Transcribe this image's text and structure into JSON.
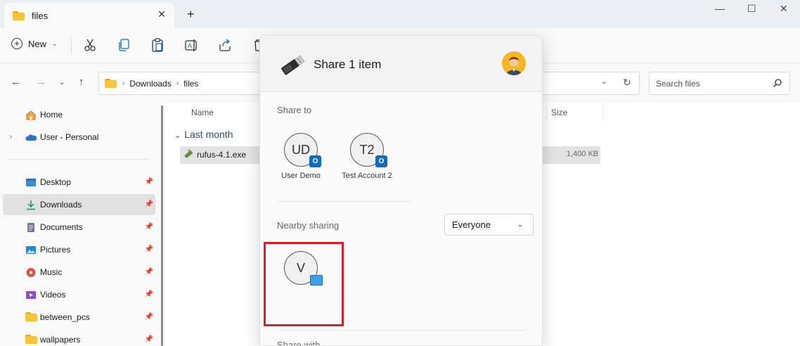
{
  "window": {
    "tab_title": "files",
    "new_tab": "+",
    "minimize": "—",
    "maximize": "☐",
    "close": "✕"
  },
  "toolbar": {
    "new_label": "New",
    "icons": [
      "cut-icon",
      "copy-icon",
      "paste-icon",
      "rename-icon",
      "share-icon",
      "delete-icon"
    ]
  },
  "address": {
    "crumbs": [
      "Downloads",
      "files"
    ],
    "search_placeholder": "Search files"
  },
  "sidebar": {
    "items": [
      {
        "label": "Home",
        "icon": "home-icon"
      },
      {
        "label": "User - Personal",
        "icon": "onedrive-icon"
      },
      {
        "label": "Desktop",
        "icon": "desktop-icon"
      },
      {
        "label": "Downloads",
        "icon": "downloads-icon"
      },
      {
        "label": "Documents",
        "icon": "documents-icon"
      },
      {
        "label": "Pictures",
        "icon": "pictures-icon"
      },
      {
        "label": "Music",
        "icon": "music-icon"
      },
      {
        "label": "Videos",
        "icon": "videos-icon"
      },
      {
        "label": "between_pcs",
        "icon": "folder-icon"
      },
      {
        "label": "wallpapers",
        "icon": "folder-icon"
      }
    ]
  },
  "filelist": {
    "columns": {
      "name": "Name",
      "size": "Size"
    },
    "group": "Last month",
    "files": [
      {
        "name": "rufus-4.1.exe",
        "size": "1,400 KB"
      }
    ]
  },
  "share": {
    "title": "Share 1 item",
    "share_to_label": "Share to",
    "contacts": [
      {
        "initials": "UD",
        "name": "User Demo",
        "badge": "O"
      },
      {
        "initials": "T2",
        "name": "Test Account 2",
        "badge": "O"
      }
    ],
    "nearby_label": "Nearby sharing",
    "nearby_option": "Everyone",
    "nearby_devices": [
      {
        "initial": "V"
      }
    ],
    "next_section_label": "Share with"
  },
  "colors": {
    "highlight": "#d2232a",
    "accent": "#0f6cbd",
    "folder": "#f8c53a"
  }
}
